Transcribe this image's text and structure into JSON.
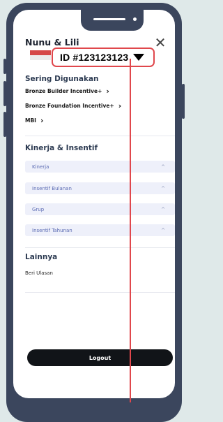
{
  "header": {
    "user_name": "Nunu & Lili",
    "account_id": "ID #123123123",
    "close_symbol": "✕"
  },
  "frequently_used": {
    "title": "Sering Digunakan",
    "items": [
      {
        "label": "Bronze Builder Incentive+"
      },
      {
        "label": "Bronze Foundation Incentive+"
      },
      {
        "label": "MBI"
      }
    ]
  },
  "performance": {
    "title": "Kinerja & Insentif",
    "items": [
      {
        "label": "Kinerja"
      },
      {
        "label": "Insentif Bulanan"
      },
      {
        "label": "Grup"
      },
      {
        "label": "Insentif Tahunan"
      }
    ]
  },
  "others": {
    "title": "Lainnya",
    "items": [
      {
        "label": "Beri Ulasan"
      }
    ]
  },
  "footer": {
    "logout_label": "Logout"
  },
  "colors": {
    "phone_frame": "#3b465d",
    "highlight": "#e0474c",
    "accordion_bg": "#eef0fa",
    "accordion_text": "#5b6bb3",
    "logout_bg": "#111418"
  },
  "icons": {
    "close": "close-icon",
    "chevron": "chevron-right-icon",
    "accordion": "chevron-up-icon",
    "dropdown": "caret-down-icon",
    "flag": "indonesia-flag-icon"
  }
}
